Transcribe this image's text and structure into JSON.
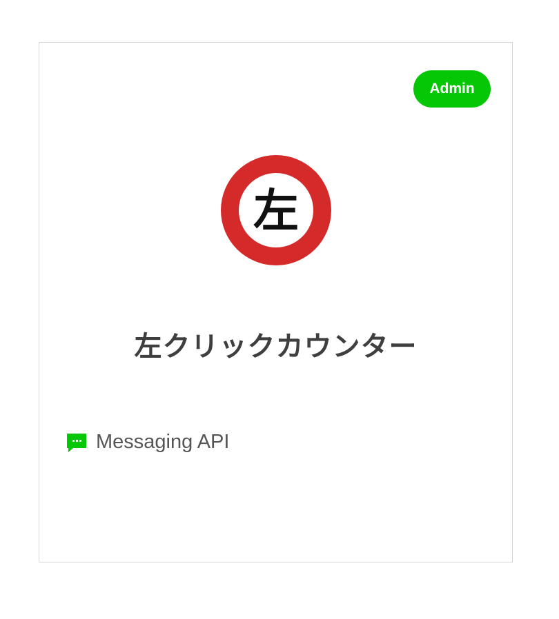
{
  "card": {
    "badge": "Admin",
    "avatar_glyph": "左",
    "avatar_icon": "left-sign-icon",
    "channel_name": "左クリックカウンター",
    "type_icon": "chat-bubble-icon",
    "type_label": "Messaging API"
  },
  "colors": {
    "badge_bg": "#06c706",
    "avatar_ring": "#d42a2a",
    "type_icon": "#06c706",
    "title_text": "#3f3f3f"
  }
}
